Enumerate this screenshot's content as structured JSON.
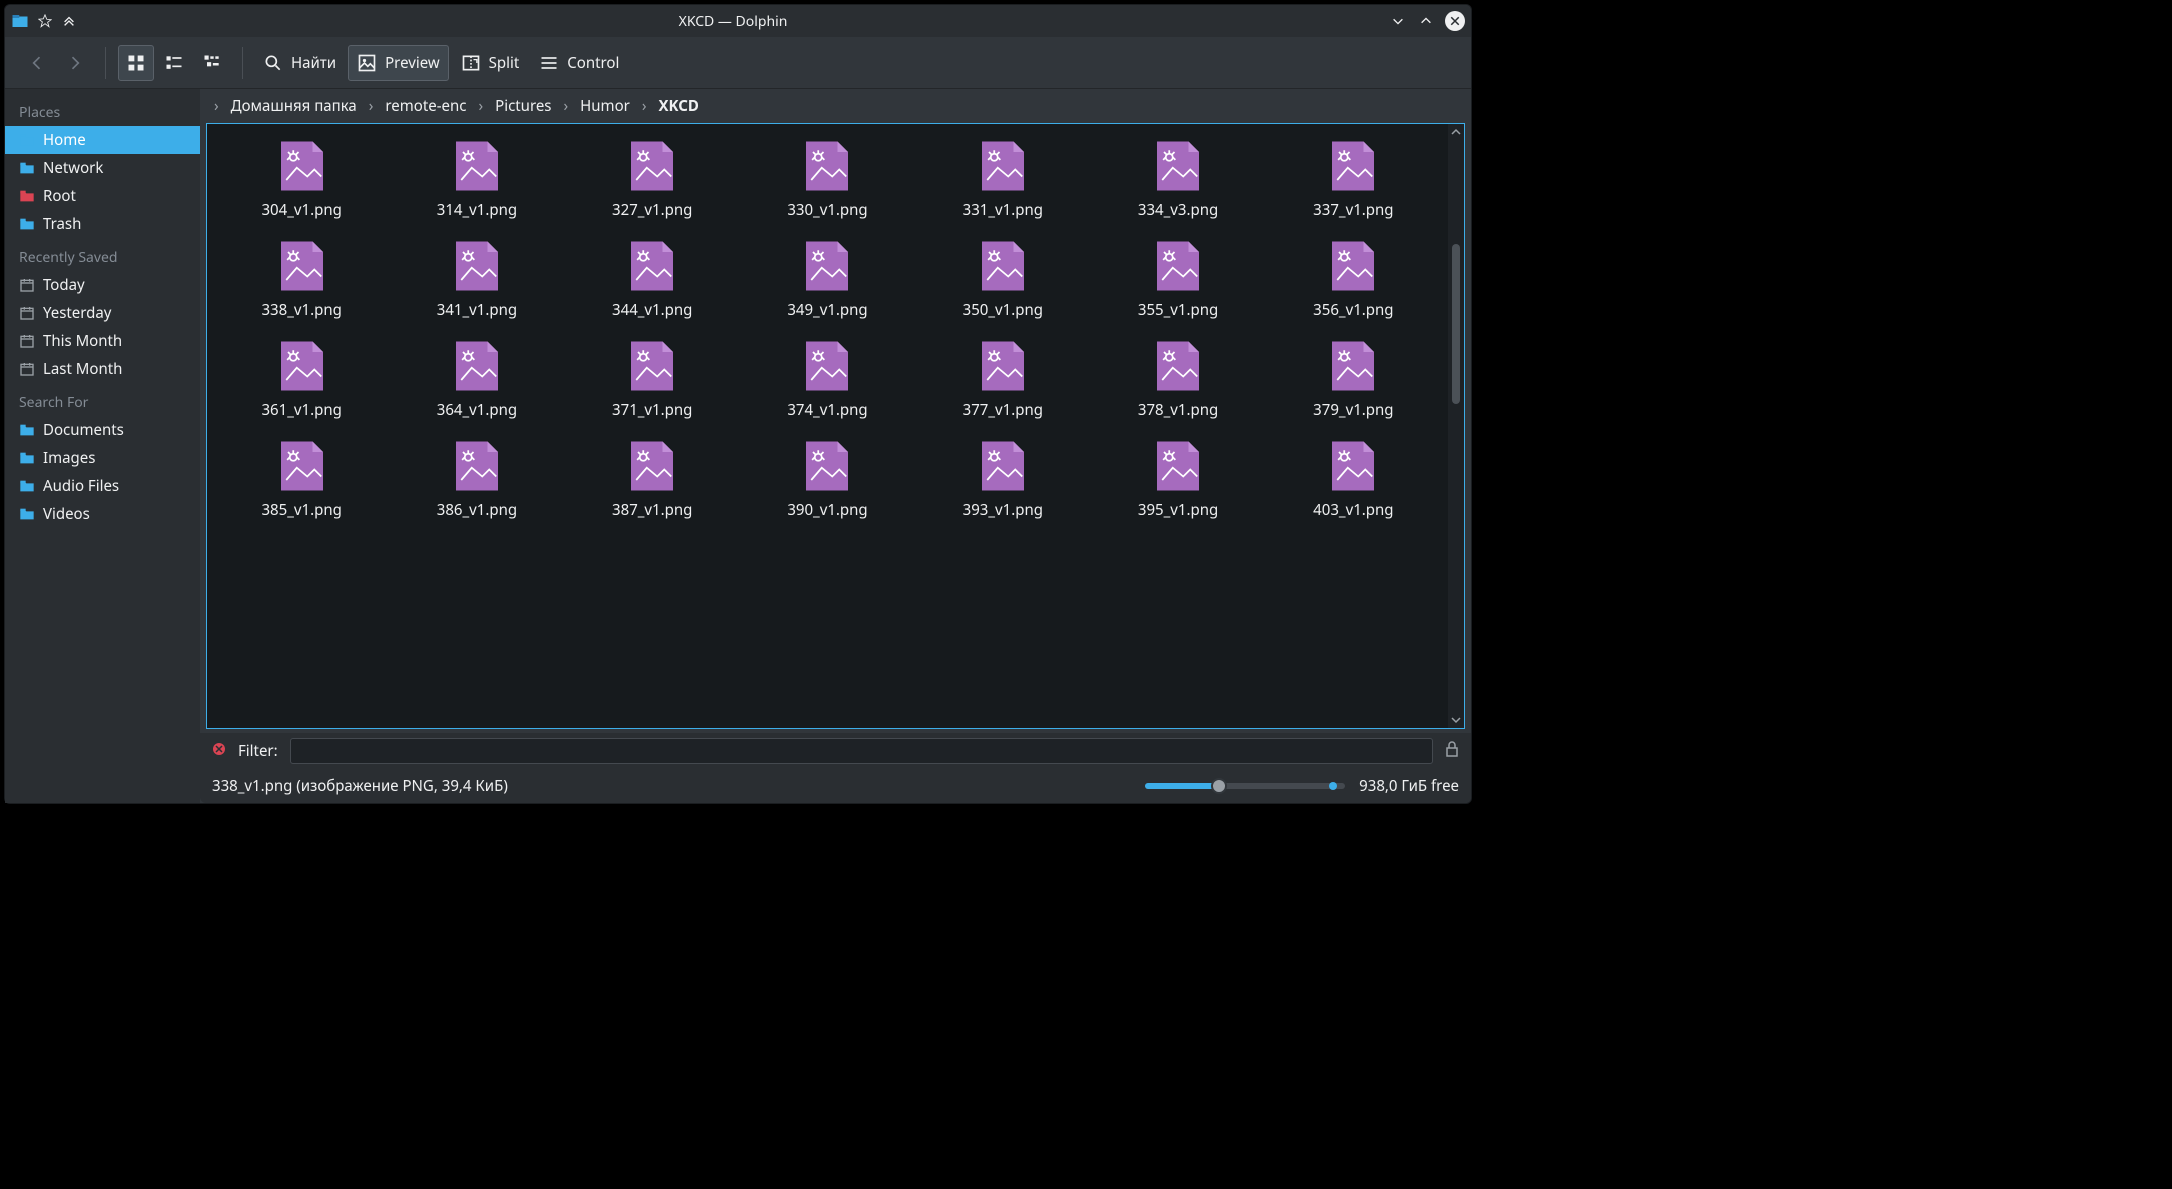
{
  "window": {
    "title": "XKCD — Dolphin"
  },
  "toolbar": {
    "find": "Найти",
    "preview": "Preview",
    "split": "Split",
    "control": "Control"
  },
  "sidebar": {
    "sections": [
      {
        "header": "Places",
        "items": [
          {
            "label": "Home",
            "icon": "folder-blue",
            "selected": true
          },
          {
            "label": "Network",
            "icon": "folder-blue",
            "selected": false
          },
          {
            "label": "Root",
            "icon": "folder-red",
            "selected": false
          },
          {
            "label": "Trash",
            "icon": "folder-blue",
            "selected": false
          }
        ]
      },
      {
        "header": "Recently Saved",
        "items": [
          {
            "label": "Today",
            "icon": "calendar",
            "selected": false
          },
          {
            "label": "Yesterday",
            "icon": "calendar",
            "selected": false
          },
          {
            "label": "This Month",
            "icon": "calendar",
            "selected": false
          },
          {
            "label": "Last Month",
            "icon": "calendar",
            "selected": false
          }
        ]
      },
      {
        "header": "Search For",
        "items": [
          {
            "label": "Documents",
            "icon": "folder-blue",
            "selected": false
          },
          {
            "label": "Images",
            "icon": "folder-blue",
            "selected": false
          },
          {
            "label": "Audio Files",
            "icon": "folder-blue",
            "selected": false
          },
          {
            "label": "Videos",
            "icon": "folder-blue",
            "selected": false
          }
        ]
      }
    ]
  },
  "breadcrumb": {
    "items": [
      {
        "label": "Домашняя папка",
        "current": false
      },
      {
        "label": "remote-enc",
        "current": false
      },
      {
        "label": "Pictures",
        "current": false
      },
      {
        "label": "Humor",
        "current": false
      },
      {
        "label": "XKCD",
        "current": true
      }
    ]
  },
  "files": [
    "304_v1.png",
    "314_v1.png",
    "327_v1.png",
    "330_v1.png",
    "331_v1.png",
    "334_v3.png",
    "337_v1.png",
    "338_v1.png",
    "341_v1.png",
    "344_v1.png",
    "349_v1.png",
    "350_v1.png",
    "355_v1.png",
    "356_v1.png",
    "361_v1.png",
    "364_v1.png",
    "371_v1.png",
    "374_v1.png",
    "377_v1.png",
    "378_v1.png",
    "379_v1.png",
    "385_v1.png",
    "386_v1.png",
    "387_v1.png",
    "390_v1.png",
    "393_v1.png",
    "395_v1.png",
    "403_v1.png"
  ],
  "filter": {
    "label": "Filter:",
    "value": ""
  },
  "status": {
    "text": "338_v1.png (изображение PNG, 39,4 КиБ)",
    "free": "938,0 ГиБ free"
  }
}
